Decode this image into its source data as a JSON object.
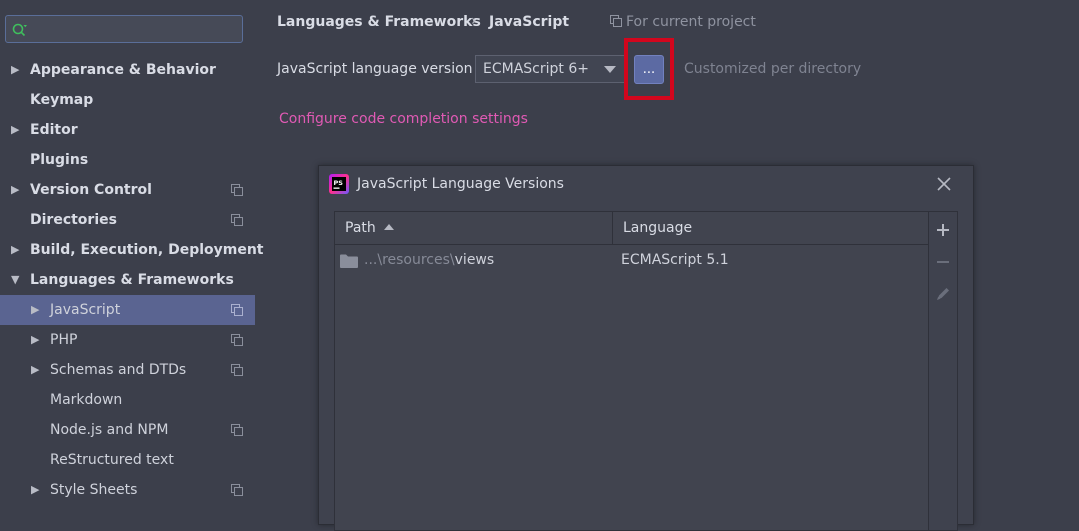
{
  "sidebar": {
    "search": {
      "value": "",
      "placeholder": ""
    },
    "items": [
      {
        "label": "Appearance & Behavior",
        "arrow": "▶"
      },
      {
        "label": "Keymap",
        "arrow": ""
      },
      {
        "label": "Editor",
        "arrow": "▶"
      },
      {
        "label": "Plugins",
        "arrow": ""
      },
      {
        "label": "Version Control",
        "arrow": "▶"
      },
      {
        "label": "Directories",
        "arrow": ""
      },
      {
        "label": "Build, Execution, Deployment",
        "arrow": "▶"
      },
      {
        "label": "Languages & Frameworks",
        "arrow": "▼"
      },
      {
        "label": "JavaScript",
        "arrow": "▶"
      },
      {
        "label": "PHP",
        "arrow": "▶"
      },
      {
        "label": "Schemas and DTDs",
        "arrow": "▶"
      },
      {
        "label": "Markdown",
        "arrow": ""
      },
      {
        "label": "Node.js and NPM",
        "arrow": ""
      },
      {
        "label": "ReStructured text",
        "arrow": ""
      },
      {
        "label": "Style Sheets",
        "arrow": "▶"
      }
    ]
  },
  "header": {
    "breadcrumb_parent": "Languages & Frameworks",
    "breadcrumb_sep": "›",
    "breadcrumb_current": "JavaScript",
    "scope": "For current project"
  },
  "settings": {
    "version_label": "JavaScript language version",
    "version_value": "ECMAScript 6+",
    "more_button": "...",
    "customized_note": "Customized per directory",
    "completion_link": "Configure code completion settings"
  },
  "dialog": {
    "title": "JavaScript Language Versions",
    "columns": {
      "path": "Path",
      "language": "Language"
    },
    "rows": [
      {
        "path_prefix": "...\\resources\\",
        "path_name": "views",
        "language": "ECMAScript 5.1"
      }
    ]
  },
  "colors": {
    "accent": "#5a6491",
    "link": "#e05ab4",
    "highlight_box": "#d2061d"
  }
}
